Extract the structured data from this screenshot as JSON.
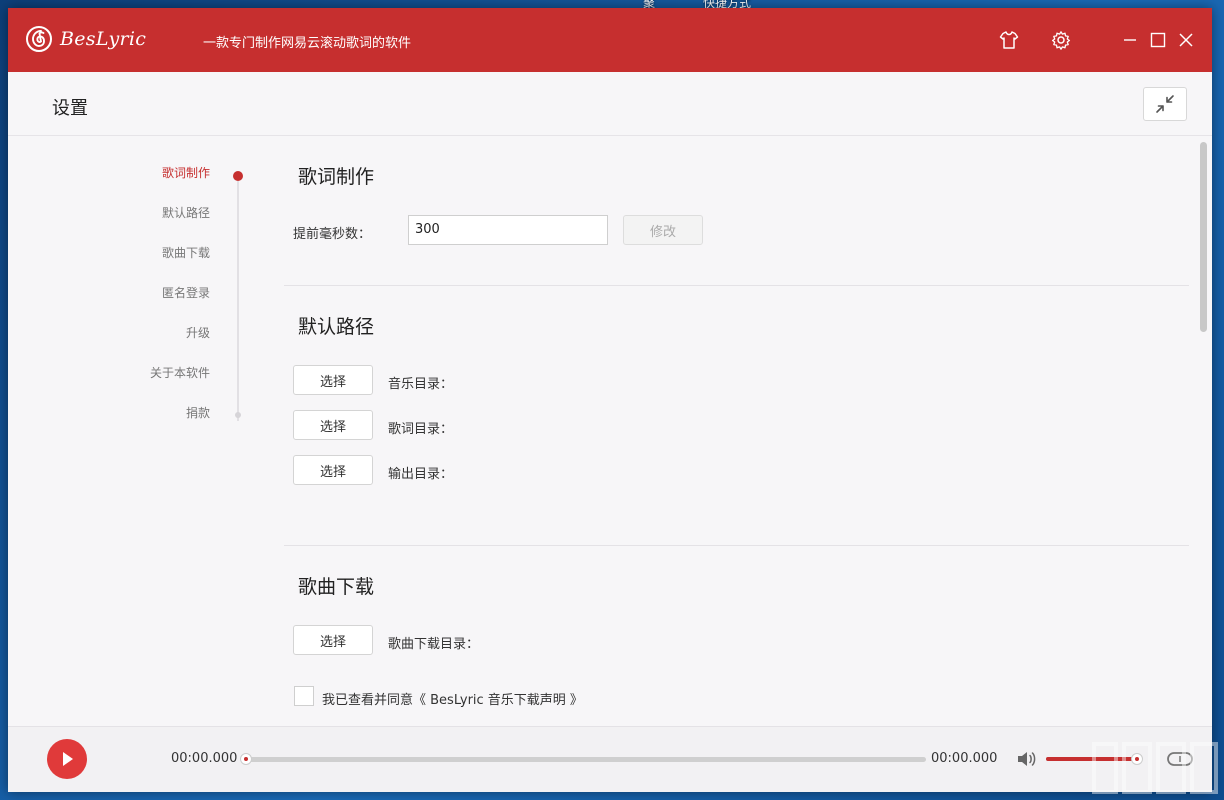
{
  "desktop": {
    "labels": [
      "聚",
      "快捷方式"
    ]
  },
  "titlebar": {
    "app_name": "BesLyric",
    "slogan": "一款专门制作网易云滚动歌词的软件",
    "bg_color": "#c62f2f"
  },
  "header": {
    "title": "设置"
  },
  "sidenav": {
    "items": [
      {
        "label": "歌词制作",
        "active": true
      },
      {
        "label": "默认路径",
        "active": false
      },
      {
        "label": "歌曲下载",
        "active": false
      },
      {
        "label": "匿名登录",
        "active": false
      },
      {
        "label": "升级",
        "active": false
      },
      {
        "label": "关于本软件",
        "active": false
      },
      {
        "label": "捐款",
        "active": false
      }
    ]
  },
  "sections": {
    "lyric": {
      "title": "歌词制作",
      "advance_label": "提前毫秒数：",
      "advance_value": "300",
      "modify_button": "修改"
    },
    "paths": {
      "title": "默认路径",
      "rows": [
        {
          "button": "选择",
          "label": "音乐目录："
        },
        {
          "button": "选择",
          "label": "歌词目录："
        },
        {
          "button": "选择",
          "label": "输出目录："
        }
      ]
    },
    "download": {
      "title": "歌曲下载",
      "button": "选择",
      "label": "歌曲下载目录：",
      "agree_text": "我已查看并同意《 BesLyric 音乐下载声明 》"
    }
  },
  "player": {
    "current_time": "00:00.000",
    "total_time": "00:00.000",
    "progress": 0,
    "volume": 0.95,
    "accent_color": "#c62f2f"
  },
  "icons": [
    "netease-logo-icon",
    "skin-shirt-icon",
    "gear-icon",
    "minimize-icon",
    "maximize-icon",
    "close-icon",
    "collapse-arrows-icon",
    "play-icon",
    "volume-icon",
    "loop-icon"
  ]
}
